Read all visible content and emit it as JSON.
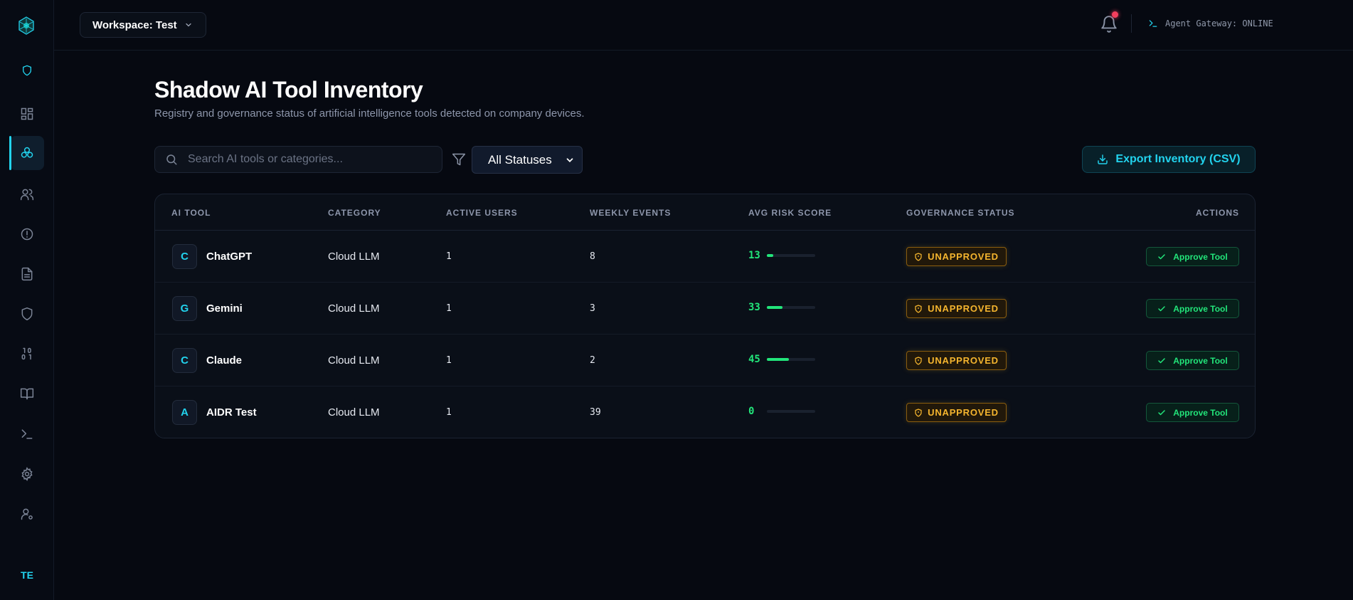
{
  "sidebar": {
    "user_initials": "TE",
    "items": [
      {
        "icon": "shield-icon"
      },
      {
        "icon": "dashboard-icon"
      },
      {
        "icon": "ai-tools-icon",
        "active": true
      },
      {
        "icon": "users-icon"
      },
      {
        "icon": "alert-icon"
      },
      {
        "icon": "document-icon"
      },
      {
        "icon": "shield-outline-icon"
      },
      {
        "icon": "binary-icon"
      },
      {
        "icon": "book-icon"
      },
      {
        "icon": "terminal-icon"
      },
      {
        "icon": "gear-icon"
      },
      {
        "icon": "user-settings-icon"
      }
    ]
  },
  "topbar": {
    "workspace_label": "Workspace: Test",
    "gateway_status": "Agent Gateway: ONLINE"
  },
  "header": {
    "title": "Shadow AI Tool Inventory",
    "subtitle": "Registry and governance status of artificial intelligence tools detected on company devices."
  },
  "toolbar": {
    "search_placeholder": "Search AI tools or categories...",
    "status_filter": "All Statuses",
    "export_label": "Export Inventory (CSV)"
  },
  "table": {
    "columns": [
      "AI TOOL",
      "CATEGORY",
      "ACTIVE USERS",
      "WEEKLY EVENTS",
      "AVG RISK SCORE",
      "GOVERNANCE STATUS",
      "ACTIONS"
    ],
    "rows": [
      {
        "initial": "C",
        "name": "ChatGPT",
        "category": "Cloud LLM",
        "active_users": "1",
        "weekly_events": "8",
        "risk_score": "13",
        "risk_pct": 13,
        "status": "UNAPPROVED",
        "action": "Approve Tool"
      },
      {
        "initial": "G",
        "name": "Gemini",
        "category": "Cloud LLM",
        "active_users": "1",
        "weekly_events": "3",
        "risk_score": "33",
        "risk_pct": 33,
        "status": "UNAPPROVED",
        "action": "Approve Tool"
      },
      {
        "initial": "C",
        "name": "Claude",
        "category": "Cloud LLM",
        "active_users": "1",
        "weekly_events": "2",
        "risk_score": "45",
        "risk_pct": 45,
        "status": "UNAPPROVED",
        "action": "Approve Tool"
      },
      {
        "initial": "A",
        "name": "AIDR Test",
        "category": "Cloud LLM",
        "active_users": "1",
        "weekly_events": "39",
        "risk_score": "0",
        "risk_pct": 0,
        "status": "UNAPPROVED",
        "action": "Approve Tool"
      }
    ]
  },
  "colors": {
    "accent": "#22d3ee",
    "risk_low": "#22e57a",
    "warning": "#f5b52e",
    "alert_dot": "#f43f5e"
  }
}
